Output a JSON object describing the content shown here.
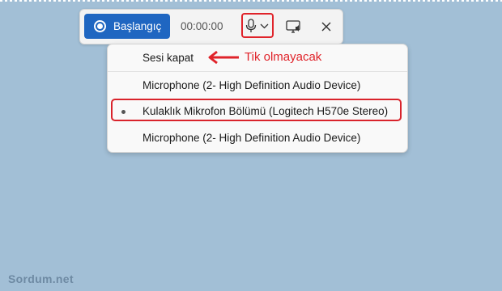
{
  "toolbar": {
    "record_label": "Başlangıç",
    "timer": "00:00:00"
  },
  "menu": {
    "items": [
      {
        "label": "Sesi kapat",
        "selected": false
      },
      {
        "label": "Microphone (2- High Definition Audio Device)",
        "selected": false
      },
      {
        "label": "Kulaklık Mikrofon Bölümü (Logitech H570e Stereo)",
        "selected": true
      },
      {
        "label": "Microphone (2- High Definition Audio Device)",
        "selected": false
      }
    ]
  },
  "annotation": {
    "text": "Tik olmayacak"
  },
  "watermark": "Sordum.net",
  "colors": {
    "background": "#a2bfd6",
    "accent": "#1f66c1",
    "highlight": "#e0232a"
  },
  "icons": [
    "record-icon",
    "mic-icon",
    "chevron-down-icon",
    "screen-cast-icon",
    "close-icon",
    "bullet-icon",
    "arrow-left-icon"
  ]
}
